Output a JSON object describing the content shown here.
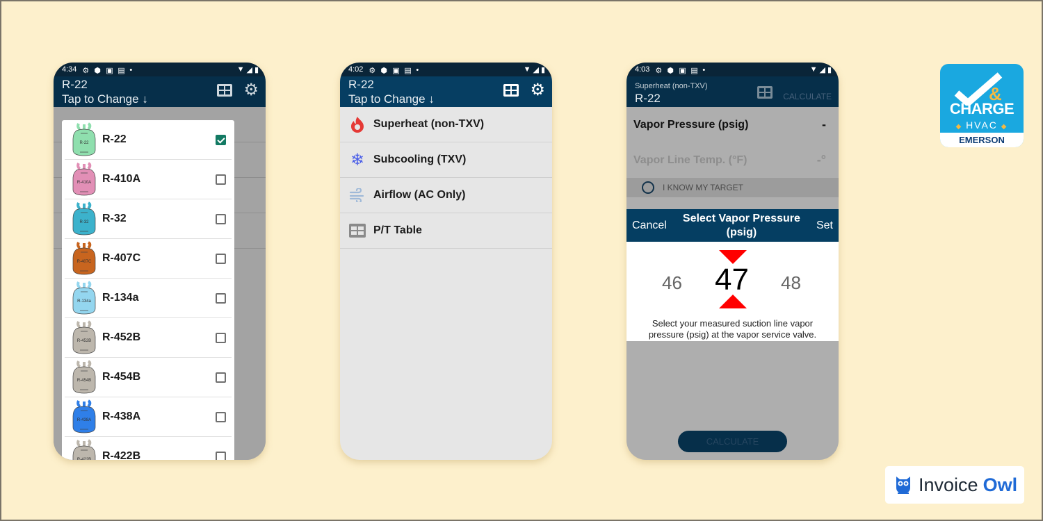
{
  "phones": [
    {
      "status_time": "4:34",
      "app_bar": {
        "line1": "R-22",
        "line2": "Tap to Change"
      },
      "refrigerants": [
        {
          "name": "R-22",
          "tank_label": "R-22",
          "color": "#8fdfae",
          "checked": true
        },
        {
          "name": "R-410A",
          "tank_label": "R-410A",
          "color": "#e28fb6",
          "checked": false
        },
        {
          "name": "R-32",
          "tank_label": "R-32",
          "color": "#3cb2cc",
          "checked": false
        },
        {
          "name": "R-407C",
          "tank_label": "R-407C",
          "color": "#c8651f",
          "checked": false
        },
        {
          "name": "R-134a",
          "tank_label": "R-134a",
          "color": "#94d6ef",
          "checked": false
        },
        {
          "name": "R-452B",
          "tank_label": "R-452B",
          "color": "#bdb7ad",
          "checked": false
        },
        {
          "name": "R-454B",
          "tank_label": "R-454B",
          "color": "#bdb7ad",
          "checked": false
        },
        {
          "name": "R-438A",
          "tank_label": "R-438A",
          "color": "#2f7fe8",
          "checked": false
        },
        {
          "name": "R-422B",
          "tank_label": "R-422B",
          "color": "#bdb7ad",
          "checked": false
        }
      ]
    },
    {
      "status_time": "4:02",
      "app_bar": {
        "line1": "R-22",
        "line2": "Tap to Change"
      },
      "menu": [
        {
          "label": "Superheat (non-TXV)",
          "icon": "flame-icon",
          "color": "#e53935"
        },
        {
          "label": "Subcooling (TXV)",
          "icon": "snowflake-icon",
          "color": "#4a5ee8"
        },
        {
          "label": "Airflow (AC Only)",
          "icon": "wind-icon",
          "color": "#9fb9d8"
        },
        {
          "label": "P/T Table",
          "icon": "table-icon",
          "color": "#8a8a8a"
        }
      ]
    },
    {
      "status_time": "4:03",
      "app_bar": {
        "line1": "Superheat (non-TXV)",
        "line2": "R-22",
        "calculate": "CALCULATE"
      },
      "vapor_pressure": {
        "label": "Vapor Pressure (psig)",
        "value": "-"
      },
      "vapor_line_temp": {
        "label": "Vapor Line Temp. (°F)",
        "value": "-°"
      },
      "know_target": "I KNOW MY TARGET",
      "picker": {
        "cancel": "Cancel",
        "title": "Select Vapor Pressure (psig)",
        "set": "Set",
        "prev": "46",
        "current": "47",
        "next": "48",
        "description": "Select your measured suction line vapor pressure (psig) at the vapor service valve."
      },
      "calculate_button": "CALCULATE"
    }
  ],
  "logos": {
    "emerson": {
      "charge": "CHARGE",
      "hvac": "HVAC",
      "brand": "EMERSON"
    },
    "invoice_owl": {
      "part1": "Invoice",
      "part2": "Owl"
    }
  }
}
